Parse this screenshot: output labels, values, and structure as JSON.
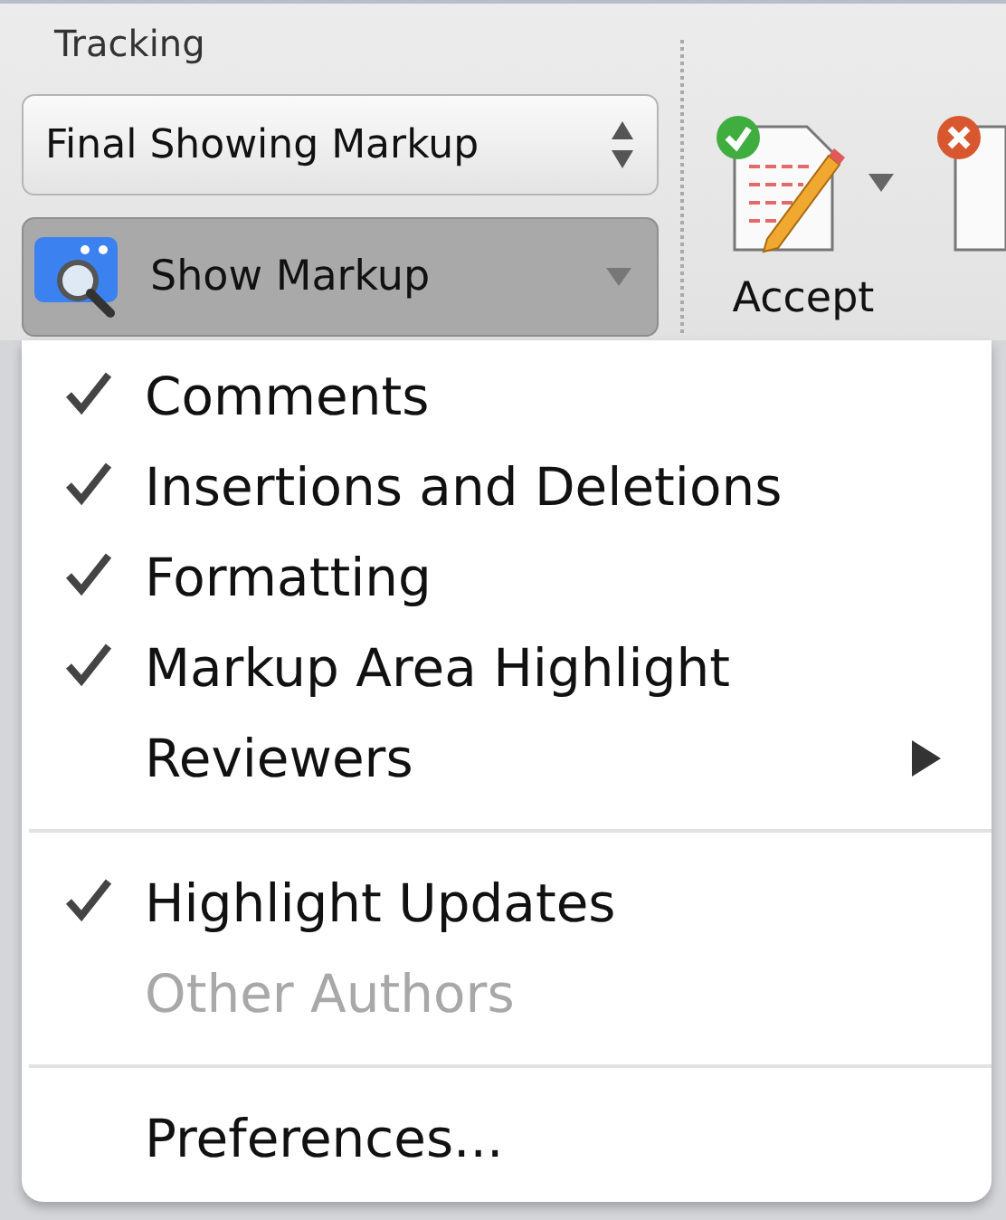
{
  "ribbon": {
    "group_title": "Tracking",
    "display_popup": {
      "value": "Final Showing Markup"
    },
    "show_markup_button": {
      "label": "Show Markup",
      "pressed": true
    },
    "accept_button": {
      "label": "Accept"
    }
  },
  "menu": {
    "sections": [
      {
        "items": [
          {
            "label": "Comments",
            "checked": true,
            "disabled": false,
            "submenu": false
          },
          {
            "label": "Insertions and Deletions",
            "checked": true,
            "disabled": false,
            "submenu": false
          },
          {
            "label": "Formatting",
            "checked": true,
            "disabled": false,
            "submenu": false
          },
          {
            "label": "Markup Area Highlight",
            "checked": true,
            "disabled": false,
            "submenu": false
          },
          {
            "label": "Reviewers",
            "checked": false,
            "disabled": false,
            "submenu": true
          }
        ]
      },
      {
        "items": [
          {
            "label": "Highlight Updates",
            "checked": true,
            "disabled": false,
            "submenu": false
          },
          {
            "label": "Other Authors",
            "checked": false,
            "disabled": true,
            "submenu": false
          }
        ]
      },
      {
        "items": [
          {
            "label": "Preferences...",
            "checked": false,
            "disabled": false,
            "submenu": false
          }
        ]
      }
    ]
  }
}
